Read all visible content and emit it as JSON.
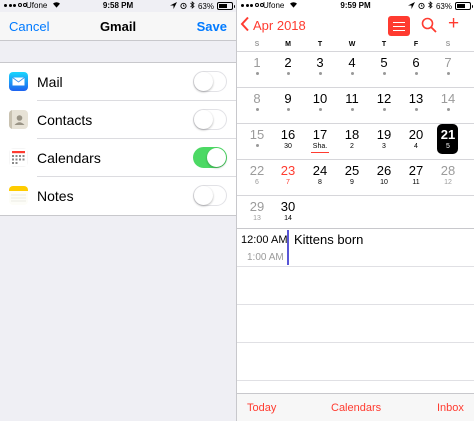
{
  "left": {
    "status": {
      "carrier": "Ufone",
      "time": "9:58 PM",
      "battery": "63%",
      "battery_level": 0.63
    },
    "nav": {
      "cancel": "Cancel",
      "title": "Gmail",
      "save": "Save"
    },
    "items": [
      {
        "label": "Mail",
        "icon": "mail-icon",
        "on": false
      },
      {
        "label": "Contacts",
        "icon": "contacts-icon",
        "on": false
      },
      {
        "label": "Calendars",
        "icon": "calendar-icon",
        "on": true
      },
      {
        "label": "Notes",
        "icon": "notes-icon",
        "on": false
      }
    ]
  },
  "right": {
    "status": {
      "carrier": "Ufone",
      "time": "9:59 PM",
      "battery": "63%",
      "battery_level": 0.63
    },
    "nav": {
      "month": "Apr 2018"
    },
    "weekdays": [
      "S",
      "M",
      "T",
      "W",
      "T",
      "F",
      "S"
    ],
    "weeks": [
      [
        {
          "n": "1",
          "s": "",
          "dot": true
        },
        {
          "n": "2",
          "s": "",
          "dot": true
        },
        {
          "n": "3",
          "s": "",
          "dot": true
        },
        {
          "n": "4",
          "s": "",
          "dot": true
        },
        {
          "n": "5",
          "s": "",
          "dot": true
        },
        {
          "n": "6",
          "s": "",
          "dot": true
        },
        {
          "n": "7",
          "s": "",
          "dot": true
        }
      ],
      [
        {
          "n": "8",
          "s": "",
          "dot": true
        },
        {
          "n": "9",
          "s": "",
          "dot": true
        },
        {
          "n": "10",
          "s": "",
          "dot": true
        },
        {
          "n": "11",
          "s": "",
          "dot": true
        },
        {
          "n": "12",
          "s": "",
          "dot": true
        },
        {
          "n": "13",
          "s": "",
          "dot": true
        },
        {
          "n": "14",
          "s": "",
          "dot": true
        }
      ],
      [
        {
          "n": "15",
          "s": "",
          "dot": true
        },
        {
          "n": "16",
          "s": "30"
        },
        {
          "n": "17",
          "s": "Sha.",
          "underline": true
        },
        {
          "n": "18",
          "s": "2"
        },
        {
          "n": "19",
          "s": "3"
        },
        {
          "n": "20",
          "s": "4"
        },
        {
          "n": "21",
          "s": "5",
          "selected": true
        }
      ],
      [
        {
          "n": "22",
          "s": "6"
        },
        {
          "n": "23",
          "s": "7",
          "today": true
        },
        {
          "n": "24",
          "s": "8"
        },
        {
          "n": "25",
          "s": "9"
        },
        {
          "n": "26",
          "s": "10"
        },
        {
          "n": "27",
          "s": "11"
        },
        {
          "n": "28",
          "s": "12"
        }
      ],
      [
        {
          "n": "29",
          "s": "13"
        },
        {
          "n": "30",
          "s": "14"
        }
      ]
    ],
    "events": [
      {
        "time": "12:00 AM",
        "title": "Kittens born"
      }
    ],
    "next_time": "1:00 AM",
    "tabs": {
      "today": "Today",
      "calendars": "Calendars",
      "inbox": "Inbox"
    },
    "accent": "#ff3b30"
  },
  "colors": {
    "ios_blue": "#007aff",
    "toggle_on": "#4cd964",
    "event_bar": "#5856d6"
  }
}
